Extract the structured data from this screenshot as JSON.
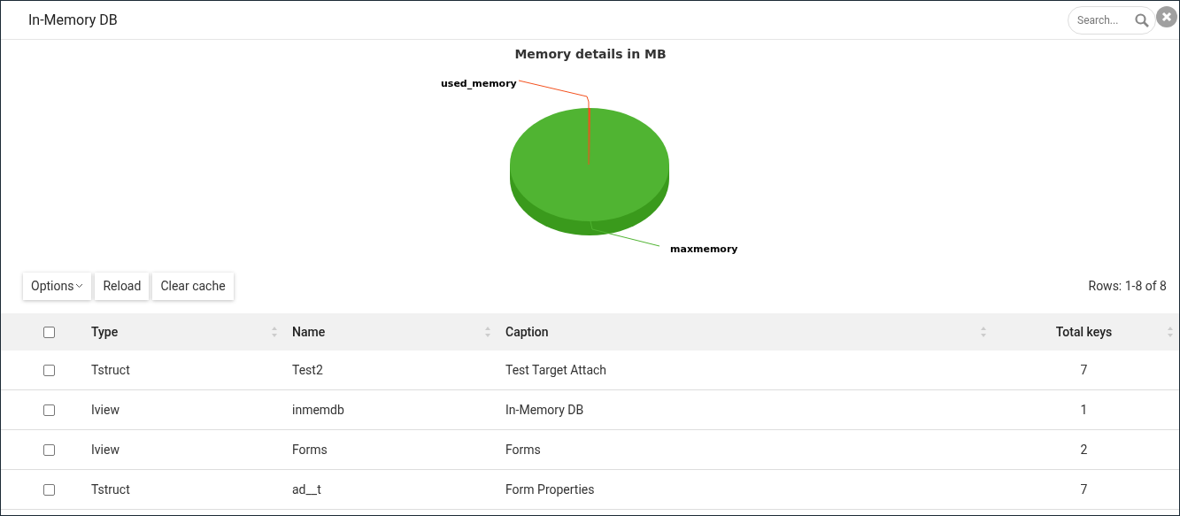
{
  "window": {
    "title": "In-Memory DB"
  },
  "search": {
    "placeholder": "Search..."
  },
  "chart": {
    "title": "Memory details in MB",
    "slices": [
      {
        "label": "used_memory",
        "color": "#f4511e"
      },
      {
        "label": "maxmemory",
        "color": "#50b432"
      }
    ]
  },
  "toolbar": {
    "buttons": [
      {
        "label": "Options",
        "kind": "dropdown"
      },
      {
        "label": "Reload",
        "kind": "plain"
      },
      {
        "label": "Clear cache",
        "kind": "plain"
      }
    ],
    "rows_info": "Rows: 1-8 of 8"
  },
  "table": {
    "all_checked": false,
    "columns": [
      "Type",
      "Name",
      "Caption",
      "Total keys"
    ],
    "rows": [
      {
        "checked": false,
        "cells": [
          "Tstruct",
          "Test2",
          "Test Target Attach",
          "7"
        ]
      },
      {
        "checked": false,
        "cells": [
          "Iview",
          "inmemdb",
          "In-Memory DB",
          "1"
        ]
      },
      {
        "checked": false,
        "cells": [
          "Iview",
          "Forms",
          "Forms",
          "2"
        ]
      },
      {
        "checked": false,
        "cells": [
          "Tstruct",
          "ad__t",
          "Form Properties",
          "7"
        ]
      }
    ]
  }
}
